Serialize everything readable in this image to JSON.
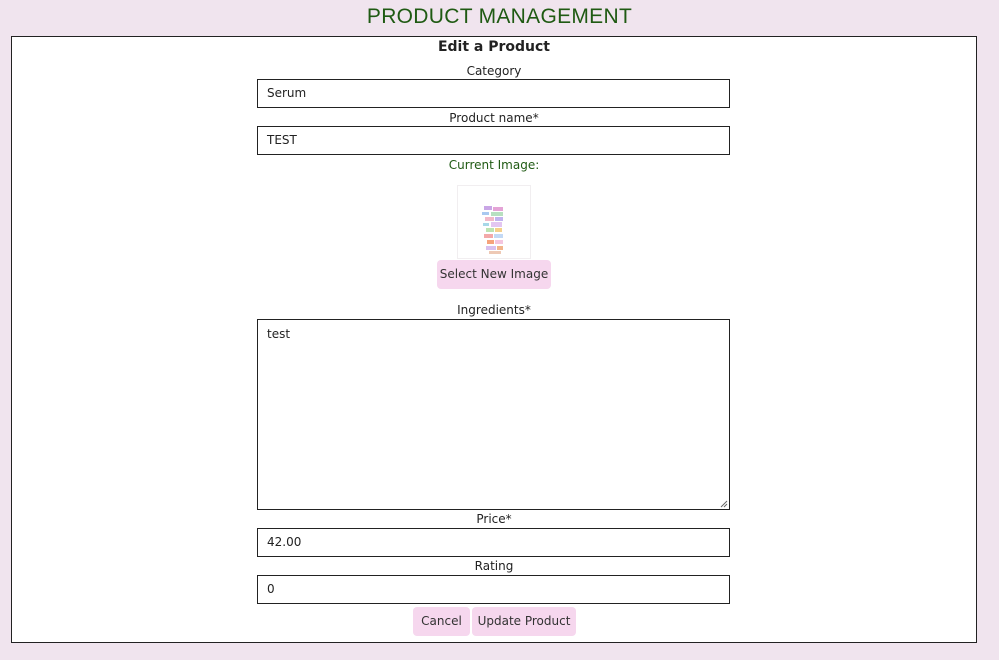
{
  "header": {
    "title": "PRODUCT MANAGEMENT"
  },
  "form": {
    "title": "Edit a Product",
    "category": {
      "label": "Category",
      "value": "Serum"
    },
    "product_name": {
      "label": "Product name*",
      "value": "TEST"
    },
    "current_image": {
      "label": "Current Image:"
    },
    "select_image_button": "Select New Image",
    "ingredients": {
      "label": "Ingredients*",
      "value": "test"
    },
    "price": {
      "label": "Price*",
      "value": "42.00"
    },
    "rating": {
      "label": "Rating",
      "value": "0"
    },
    "cancel_button": "Cancel",
    "update_button": "Update Product"
  },
  "colors": {
    "page_background": "#f0e4ee",
    "title_green": "#1f5a13",
    "button_pink": "#f6d7ee"
  }
}
